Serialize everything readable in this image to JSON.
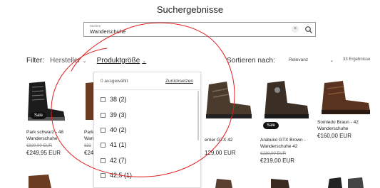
{
  "page": {
    "title": "Suchergebnisse"
  },
  "search": {
    "label": "Suchen",
    "value": "Wanderschuhe",
    "clear_icon": "close-icon",
    "submit_icon": "search-icon"
  },
  "filters": {
    "label": "Filter:",
    "items": [
      {
        "label": "Hersteller",
        "icon": "chevron-down-icon"
      },
      {
        "label": "Produktgröße",
        "icon": "chevron-down-icon",
        "active": true
      }
    ]
  },
  "sort": {
    "label": "Sortieren nach:",
    "value": "Relevanz"
  },
  "results_count": "33 Ergebnisse",
  "size_panel": {
    "selected_text": "0 ausgewählt",
    "reset_label": "Zurücksetzen",
    "options": [
      "38 (2)",
      "39 (3)",
      "40 (2)",
      "41 (1)",
      "42 (7)",
      "42,5 (1)"
    ]
  },
  "products": [
    {
      "name": "Park schwarz - 48",
      "name2": "Wanderschuhe",
      "old_price": "€320,00 EUR",
      "price": "€249,95 EUR",
      "badge": "Sale"
    },
    {
      "name": "Park",
      "name2": "Wan",
      "old_price": "€32",
      "price": "€24"
    },
    {
      "name": "errier GTX 42",
      "name2": "",
      "old_price": "",
      "price": "129,00 EUR"
    },
    {
      "name": "Arabuko GTX Brown -",
      "name2": "Wanderschuhe 42",
      "old_price": "€239,00 EUR",
      "price": "€219,00 EUR",
      "badge": "Sale"
    },
    {
      "name": "Somiedo Braun - 42",
      "name2": "Wanderschuhe",
      "old_price": "",
      "price": "€160,00 EUR"
    }
  ],
  "colors": {
    "annotation": "#e02020",
    "text": "#222222",
    "border": "#9a9a9a"
  }
}
